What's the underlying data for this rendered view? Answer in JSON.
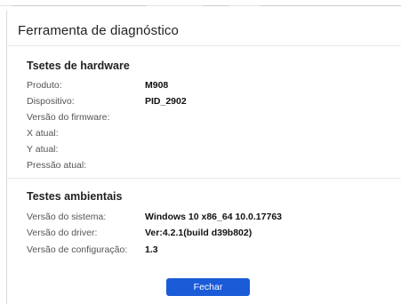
{
  "dialog": {
    "title": "Ferramenta de diagnóstico"
  },
  "hardware": {
    "title": "Tsetes de hardware",
    "rows": [
      {
        "label": "Produto:",
        "value": "M908"
      },
      {
        "label": "Dispositivo:",
        "value": "PID_2902"
      },
      {
        "label": "Versão do firmware:",
        "value": ""
      },
      {
        "label": "X atual:",
        "value": ""
      },
      {
        "label": "Y atual:",
        "value": ""
      },
      {
        "label": "Pressão atual:",
        "value": ""
      }
    ]
  },
  "environment": {
    "title": "Testes ambientais",
    "rows": [
      {
        "label": "Versão do sistema:",
        "value": "Windows 10 x86_64 10.0.17763"
      },
      {
        "label": "Versão do driver:",
        "value": "Ver:4.2.1(build d39b802)"
      },
      {
        "label": "Versão de configuração:",
        "value": "1.3"
      }
    ]
  },
  "buttons": {
    "close": "Fechar"
  },
  "colors": {
    "accent": "#1a5bd8"
  }
}
